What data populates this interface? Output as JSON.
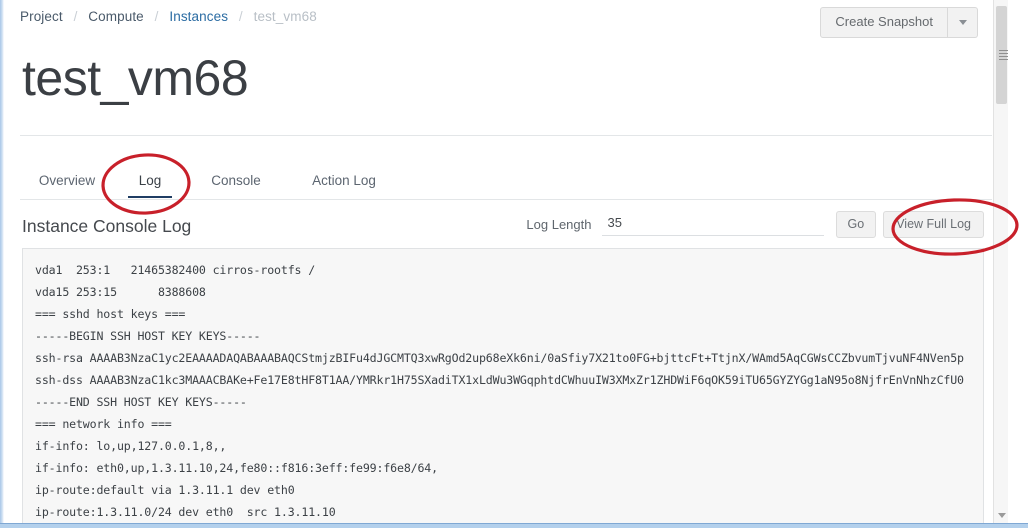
{
  "breadcrumb": {
    "items": [
      {
        "label": "Project",
        "state": "plain"
      },
      {
        "label": "Compute",
        "state": "plain"
      },
      {
        "label": "Instances",
        "state": "link"
      },
      {
        "label": "test_vm68",
        "state": "current"
      }
    ],
    "separator": "/"
  },
  "header": {
    "title": "test_vm68",
    "create_snapshot_label": "Create Snapshot",
    "dropdown_icon": "chevron-down-icon"
  },
  "tabs": [
    {
      "label": "Overview",
      "active": false
    },
    {
      "label": "Log",
      "active": true
    },
    {
      "label": "Console",
      "active": false
    },
    {
      "label": "Action Log",
      "active": false
    }
  ],
  "log_section": {
    "heading": "Instance Console Log",
    "log_length_label": "Log Length",
    "log_length_value": "35",
    "log_length_placeholder": "",
    "go_label": "Go",
    "view_full_log_label": "View Full Log"
  },
  "console_log": {
    "lines": [
      "vda1  253:1   21465382400 cirros-rootfs /",
      "vda15 253:15      8388608",
      "=== sshd host keys ===",
      "-----BEGIN SSH HOST KEY KEYS-----",
      "ssh-rsa AAAAB3NzaC1yc2EAAAADAQABAAABAQCStmjzBIFu4dJGCMTQ3xwRgOd2up68eXk6ni/0aSfiy7X21to0FG+bjttcFt+TtjnX/WAmd5AqCGWsCCZbvumTjvuNF4NVen5p",
      "ssh-dss AAAAB3NzaC1kc3MAAACBAKe+Fe17E8tHF8T1AA/YMRkr1H75SXadiTX1xLdWu3WGqphtdCWhuuIW3XMxZr1ZHDWiF6qOK59iTU65GYZYGg1aN95o8NjfrEnVnNhzCfU0",
      "-----END SSH HOST KEY KEYS-----",
      "=== network info ===",
      "if-info: lo,up,127.0.0.1,8,,",
      "if-info: eth0,up,1.3.11.10,24,fe80::f816:3eff:fe99:f6e8/64,",
      "ip-route:default via 1.3.11.1 dev eth0",
      "ip-route:1.3.11.0/24 dev eth0  src 1.3.11.10"
    ]
  },
  "annotations": {
    "color": "#c8202a",
    "items": [
      {
        "name": "annotation-ellipse-log-tab"
      },
      {
        "name": "annotation-ellipse-view-full-log"
      }
    ]
  },
  "scrollbar": {
    "down_arrow_icon": "chevron-down-icon",
    "grip_icon": "grip-lines-icon"
  }
}
